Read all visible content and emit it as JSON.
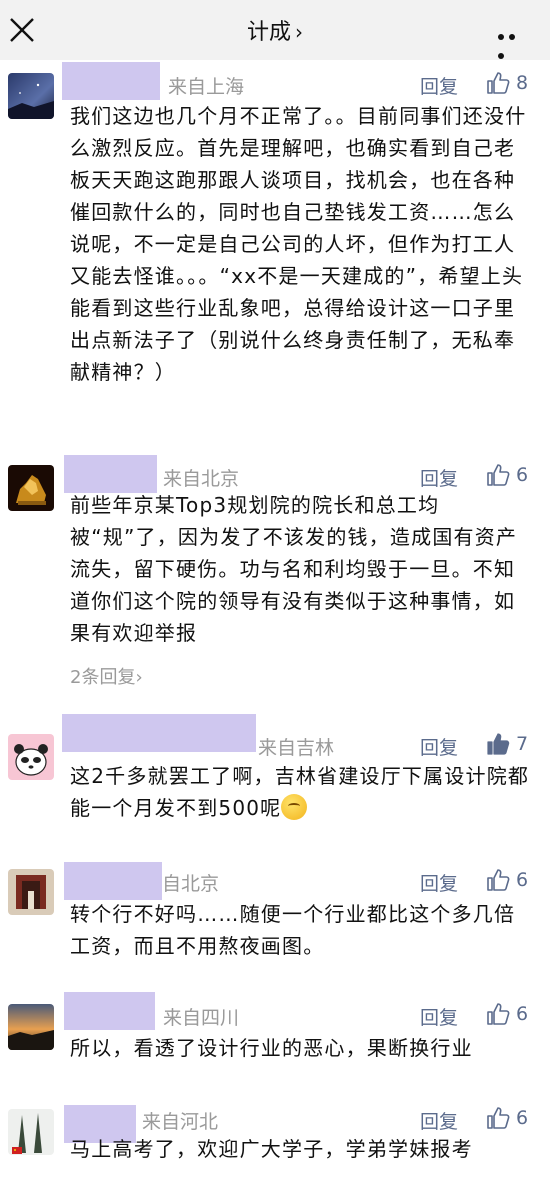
{
  "header": {
    "title": "计成",
    "title_chevron": "›",
    "close_icon": "close-icon",
    "more_icon": "more-dots-icon"
  },
  "comments": [
    {
      "location": "来自上海",
      "reply": "回复",
      "likes": "8",
      "liked": false,
      "text": "我们这边也几个月不正常了。。目前同事们还没什么激烈反应。首先是理解吧，也确实看到自己老板天天跑这跑那跟人谈项目，找机会，也在各种催回款什么的，同时也自己垫钱发工资……怎么说呢，不一定是自己公司的人坏，但作为打工人又能去怪谁。。。“xx不是一天建成的”，希望上头能看到这些行业乱象吧，总得给设计这一口子里出点新法子了（别说什么终身责任制了，无私奉献精神？）"
    },
    {
      "location": "来自北京",
      "reply": "回复",
      "likes": "6",
      "liked": false,
      "text": "前些年京某Top3规划院的院长和总工均被“规”了，因为发了不该发的钱，造成国有资产流失，留下硬伤。功与名和利均毁于一旦。不知道你们这个院的领导有没有类似于这种事情，如果有欢迎举报",
      "more_replies": "2条回复"
    },
    {
      "location": "来自吉林",
      "reply": "回复",
      "likes": "7",
      "liked": true,
      "text": "这2千多就罢工了啊，吉林省建设厅下属设计院都能一个月发不到500呢"
    },
    {
      "location": "自北京",
      "reply": "回复",
      "likes": "6",
      "liked": false,
      "text": "转个行不好吗……随便一个行业都比这个多几倍工资，而且不用熬夜画图。"
    },
    {
      "location": "来自四川",
      "reply": "回复",
      "likes": "6",
      "liked": false,
      "text": "所以，看透了设计行业的恶心，果断换行业"
    },
    {
      "location": "来自河北",
      "reply": "回复",
      "likes": "6",
      "liked": false,
      "text": "马上高考了，欢迎广大学子，学弟学妹报考"
    }
  ],
  "colors": {
    "name_mask": "#cfc7ef",
    "link": "#5b6b8c",
    "meta": "#9a9a9a",
    "like_filled": "#5b6b8c"
  }
}
